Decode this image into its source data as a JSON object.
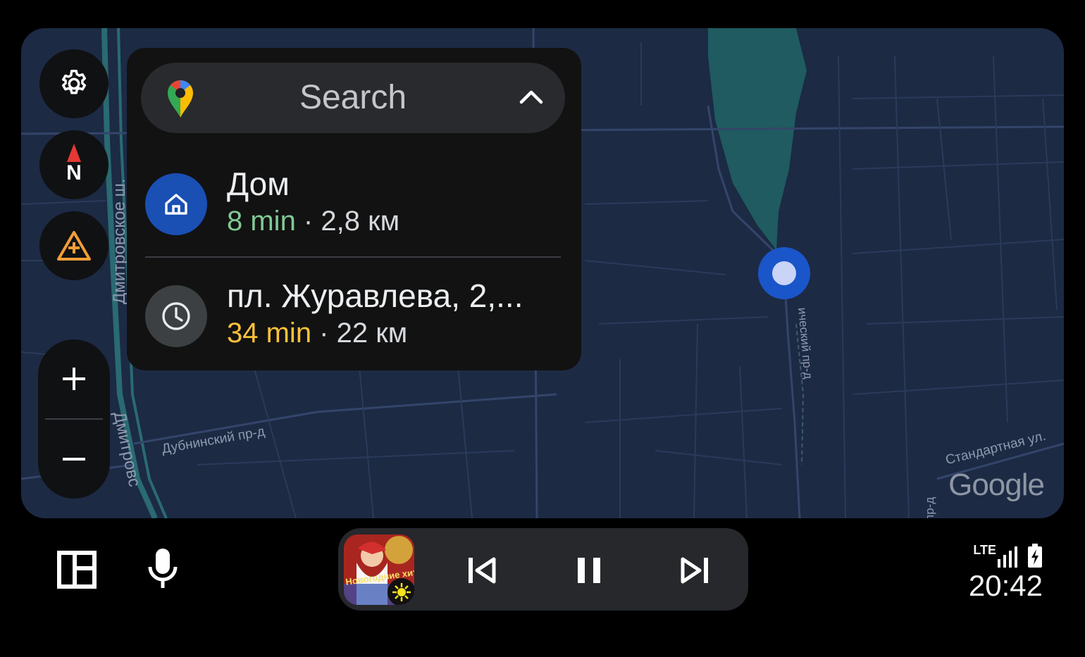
{
  "map": {
    "street_labels": {
      "dmitrovskoe_top": "Дмитровское ш.",
      "dmitrovskoe_bottom": "Дмитровс",
      "dubninsky": "Дубнинский пр-д",
      "vertical_right": "ический пр-д",
      "standartnaya": "Стандартная ул.",
      "edge_bottom": "пр-д"
    },
    "attribution": "Google"
  },
  "controls": {
    "settings_icon": "gear-icon",
    "compass_letter": "N",
    "report_icon": "warning-add-icon",
    "zoom_in": "+",
    "zoom_out": "−"
  },
  "search": {
    "label": "Search",
    "logo_icon": "google-maps-pin-icon",
    "toggle_icon": "chevron-up-icon"
  },
  "destinations": [
    {
      "icon": "home-icon",
      "title": "Дом",
      "eta": "8 min",
      "separator": " · ",
      "distance": "2,8 км",
      "eta_color": "#81c995",
      "icon_bg": "#1a4fb4"
    },
    {
      "icon": "history-icon",
      "title": "пл. Журавлева, 2,...",
      "eta": "34 min",
      "separator": " · ",
      "distance": "22 км",
      "eta_color": "#fdc13b",
      "icon_bg": "#3c4043"
    }
  ],
  "bottom_bar": {
    "launcher_icon": "dashboard-icon",
    "mic_icon": "microphone-icon"
  },
  "media": {
    "album_text": "Новогодние хиты",
    "prev_icon": "skip-previous-icon",
    "pause_icon": "pause-icon",
    "next_icon": "skip-next-icon"
  },
  "status": {
    "network": "LTE",
    "time": "20:42"
  },
  "colors": {
    "map_bg": "#1c2a44",
    "water": "#1f5b60",
    "location": "#1a56c9"
  }
}
